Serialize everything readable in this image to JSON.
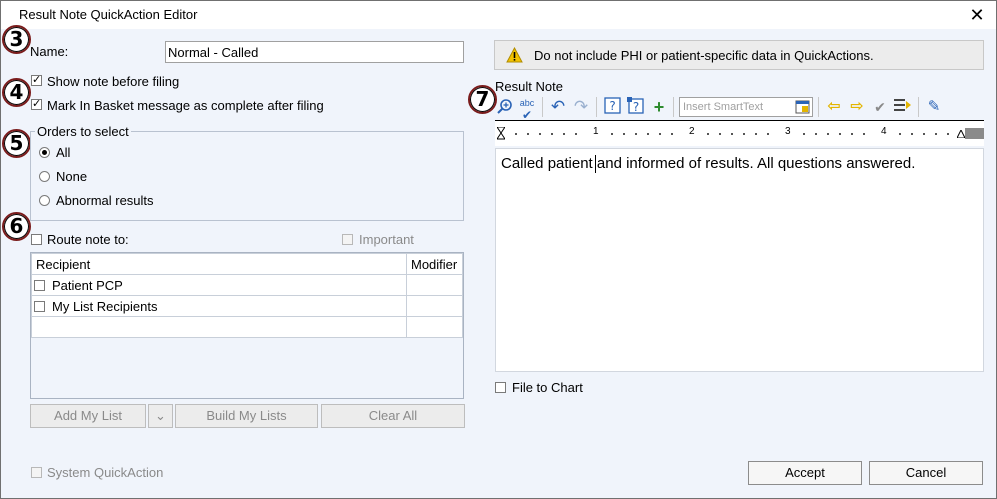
{
  "window": {
    "title": "Result Note QuickAction Editor",
    "close_glyph": "✕"
  },
  "markers": [
    "3",
    "4",
    "5",
    "6",
    "7"
  ],
  "name_field": {
    "label": "Name:",
    "value": "Normal - Called"
  },
  "options": {
    "show_note": {
      "label": "Show note before filing",
      "checked": true
    },
    "mark_complete": {
      "label": "Mark In Basket message as complete after filing",
      "checked": true
    }
  },
  "orders": {
    "title": "Orders to select",
    "items": [
      {
        "label": "All",
        "selected": true
      },
      {
        "label": "None",
        "selected": false
      },
      {
        "label": "Abnormal results",
        "selected": false
      }
    ]
  },
  "route": {
    "label": "Route note to:",
    "important_label": "Important",
    "columns": [
      "Recipient",
      "Modifier"
    ],
    "rows": [
      {
        "recipient": "Patient PCP",
        "modifier": ""
      },
      {
        "recipient": "My List Recipients",
        "modifier": ""
      },
      {
        "recipient": "",
        "modifier": ""
      }
    ]
  },
  "route_buttons": {
    "add": "Add My List",
    "dropdown": "⌄",
    "build": "Build My Lists",
    "clear": "Clear All"
  },
  "system_quickaction": "System QuickAction",
  "warning": {
    "icon": "warning-icon",
    "text": "Do not include PHI or patient-specific data in QuickActions."
  },
  "result_note": {
    "label": "Result Note",
    "smarttext_placeholder": "Insert SmartText",
    "ruler_numbers": [
      "1",
      "2",
      "3",
      "4"
    ],
    "body": "Called patient and informed of results. All questions answered."
  },
  "file_to_chart": "File to Chart",
  "buttons": {
    "accept": "Accept",
    "cancel": "Cancel"
  },
  "colors": {
    "marker_border": "#7a1c1c",
    "warning_icon": "#f2c200",
    "undo_blue": "#2a63b6",
    "add_green": "#2e8b2e",
    "arrow_yellow": "#e3b500"
  }
}
